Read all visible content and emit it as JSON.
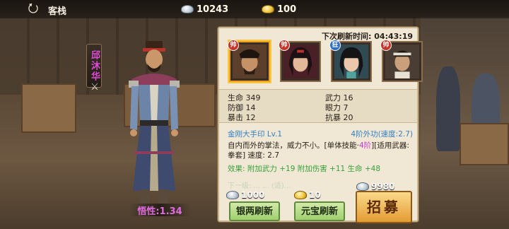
{
  "header": {
    "back_label": "back",
    "title": "客栈",
    "silver": "10243",
    "gold": "100"
  },
  "hero": {
    "name": "邱沐华",
    "aptitude": "悟性:1.34"
  },
  "panel": {
    "refresh_time": "下次刷新时间: 04:43:19",
    "portraits": [
      {
        "grade": "帅",
        "grade_color": "#c8342a"
      },
      {
        "grade": "帅",
        "grade_color": "#c8342a"
      },
      {
        "grade": "狂",
        "grade_color": "#2d6fc6"
      },
      {
        "grade": "帅",
        "grade_color": "#c8342a"
      }
    ],
    "stats": {
      "hp": "生命 349",
      "defense": "防御 14",
      "crit": "暴击 12",
      "force": "武力 16",
      "eye": "眼力 7",
      "resist": "抗暴 20"
    },
    "skill": {
      "name": "金刚大手印  Lv.1",
      "tier": "4阶外功(速度:2.7)",
      "desc_a": "自内而外的掌法，威力不小。[单体技能·",
      "desc_tier": "4阶",
      "desc_b": "][适用武器: 拳套] 速度: 2.7",
      "effect": "效果: 附加武力 +19  附加伤害 +11  生命 +48",
      "faded": "下一级: ...                        ... (适)..."
    }
  },
  "actions": {
    "silver_cost": "1000",
    "gold_cost": "10",
    "recruit_cost": "9980",
    "silver_refresh": "银两刷新",
    "gold_refresh": "元宝刷新",
    "recruit": "招募"
  },
  "colors": {
    "name_color": "#e04bd6",
    "skill_blue": "#2f7fc4",
    "effect_green": "#38a13a",
    "accent_gold": "#f0a318"
  }
}
